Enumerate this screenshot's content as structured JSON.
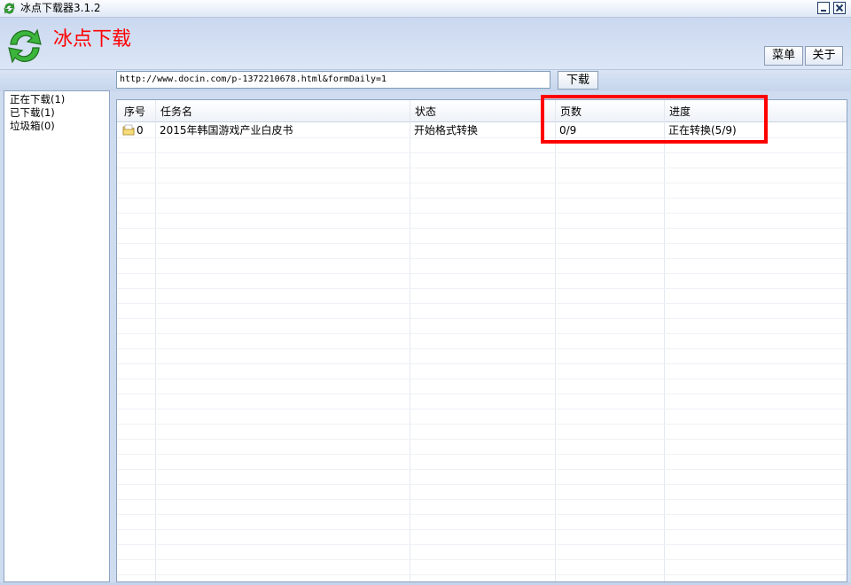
{
  "window": {
    "title": "冰点下载器3.1.2",
    "title_icon": "refresh-arrows-icon"
  },
  "header": {
    "app_name": "冰点下载",
    "app_name_color": "#ff0000",
    "logo_icon": "green-refresh-arrows-icon",
    "menu_label": "菜单",
    "about_label": "关于"
  },
  "toolbar": {
    "url_value": "http://www.docin.com/p-1372210678.html&formDaily=1",
    "download_label": "下载"
  },
  "sidebar": {
    "items": [
      {
        "label": "正在下载(1)"
      },
      {
        "label": "已下载(1)"
      },
      {
        "label": "垃圾箱(0)"
      }
    ]
  },
  "task_list": {
    "columns": [
      "序号",
      "任务名",
      "状态",
      "页数",
      "进度"
    ],
    "rows": [
      {
        "index": "0",
        "name": "2015年韩国游戏产业白皮书",
        "status": "开始格式转换",
        "pages": "0/9",
        "progress": "正在转换(5/9)",
        "icon": "document-folder-icon"
      }
    ]
  },
  "highlight": {
    "color": "#ff0000"
  }
}
